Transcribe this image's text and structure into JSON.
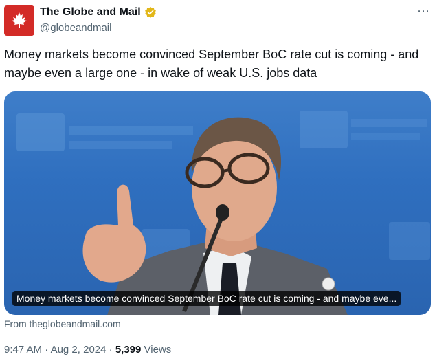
{
  "account": {
    "display_name": "The Globe and Mail",
    "handle": "@globeandmail",
    "brand_color": "#d32b27",
    "verified_color": "#e2b719"
  },
  "more_icon": "⋯",
  "tweet": {
    "text": "Money markets become convinced September BoC rate cut is coming - and maybe even a large one - in wake of weak U.S. jobs data"
  },
  "card": {
    "caption": "Money markets become convinced September BoC rate cut is coming - and maybe eve...",
    "source": "From theglobeandmail.com"
  },
  "meta": {
    "time": "9:47 AM",
    "separator": "·",
    "date": "Aug 2, 2024",
    "views_count": "5,399",
    "views_label": "Views"
  }
}
